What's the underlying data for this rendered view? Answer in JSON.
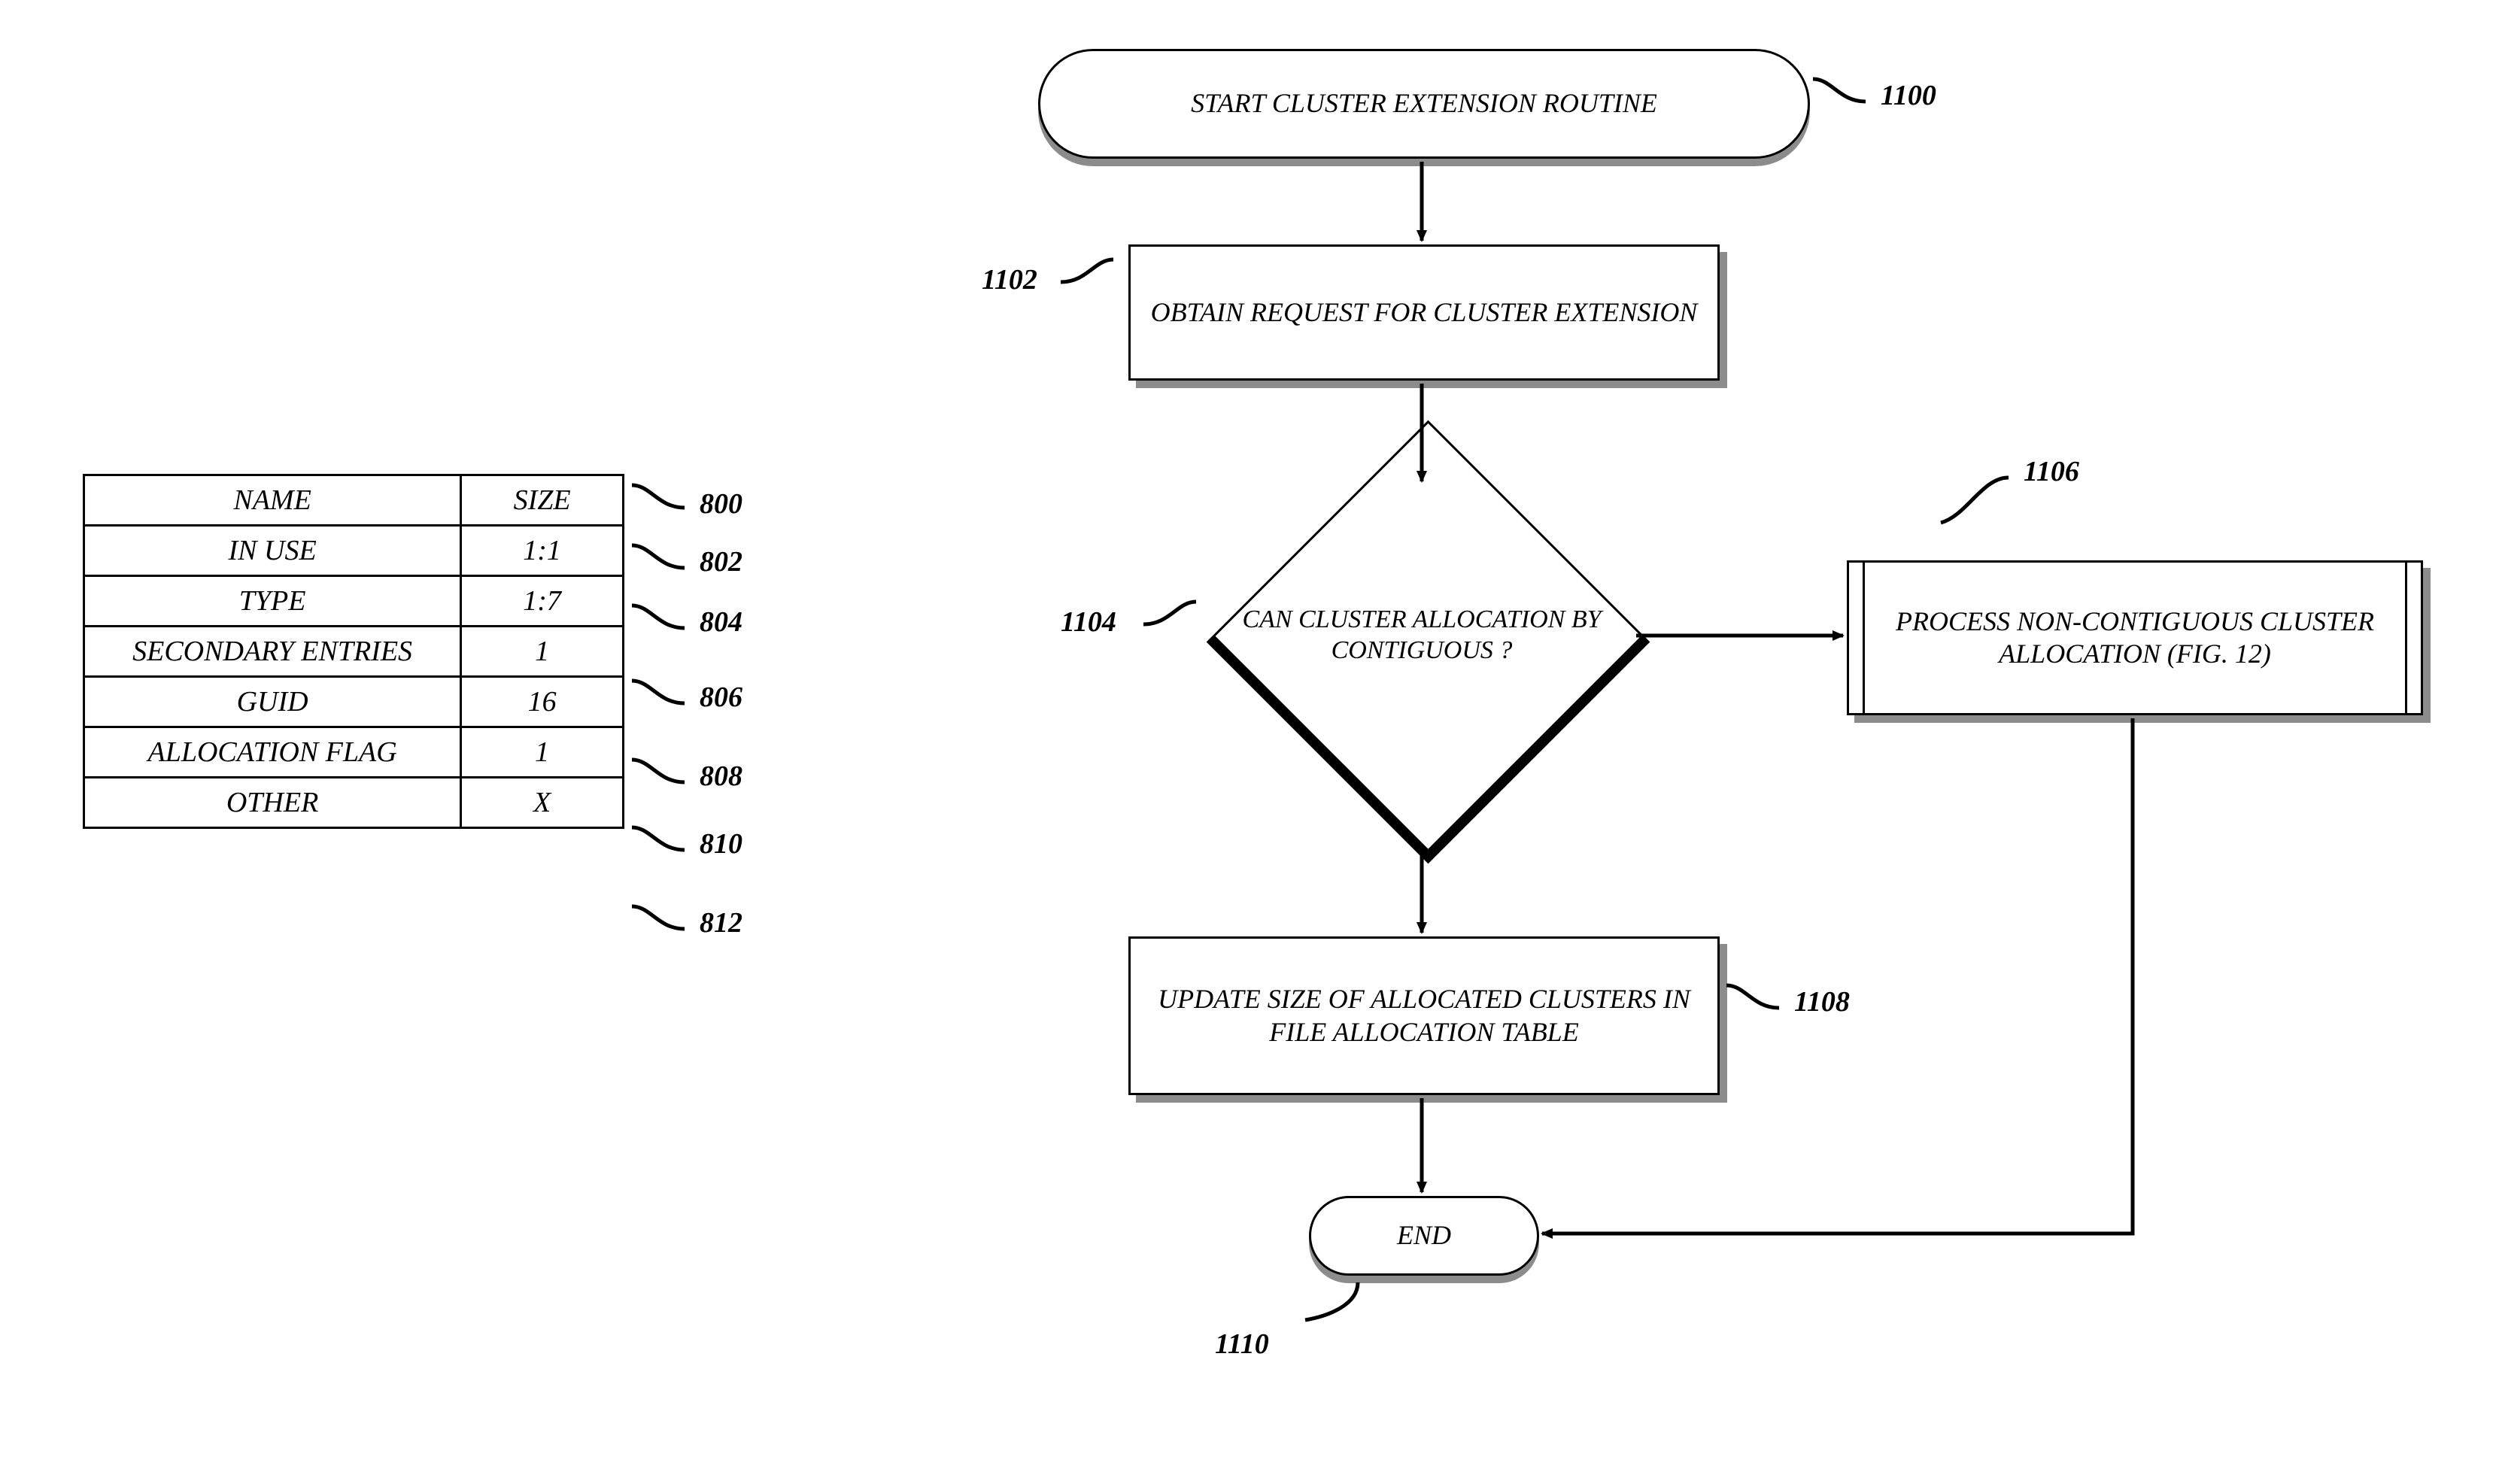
{
  "table": {
    "header": {
      "name": "NAME",
      "size": "SIZE",
      "ref": "800"
    },
    "rows": [
      {
        "name": "IN USE",
        "size": "1:1",
        "ref": "802"
      },
      {
        "name": "TYPE",
        "size": "1:7",
        "ref": "804"
      },
      {
        "name": "SECONDARY ENTRIES",
        "size": "1",
        "ref": "806"
      },
      {
        "name": "GUID",
        "size": "16",
        "ref": "808"
      },
      {
        "name": "ALLOCATION FLAG",
        "size": "1",
        "ref": "810"
      },
      {
        "name": "OTHER",
        "size": "X",
        "ref": "812"
      }
    ]
  },
  "flow": {
    "start": {
      "text": "START CLUSTER EXTENSION ROUTINE",
      "ref": "1100"
    },
    "obtain": {
      "text": "OBTAIN REQUEST FOR CLUSTER EXTENSION",
      "ref": "1102"
    },
    "decision": {
      "text": "CAN CLUSTER ALLOCATION BY CONTIGUOUS ?",
      "ref": "1104"
    },
    "noncontig": {
      "text": "PROCESS NON-CONTIGUOUS CLUSTER ALLOCATION (FIG. 12)",
      "ref": "1106"
    },
    "update": {
      "text": "UPDATE SIZE OF ALLOCATED CLUSTERS IN FILE ALLOCATION TABLE",
      "ref": "1108"
    },
    "end": {
      "text": "END",
      "ref": "1110"
    }
  }
}
